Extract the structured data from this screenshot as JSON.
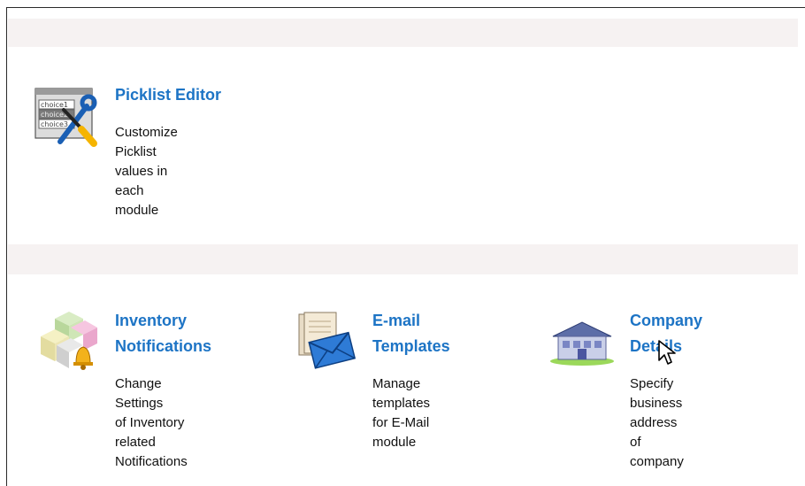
{
  "sections": [
    {
      "items": [
        {
          "title_line1": "Picklist Editor",
          "title_line2": "",
          "desc_line1": "Customize Picklist",
          "desc_line2": "values in each",
          "desc_line3": "module",
          "desc_line4": "",
          "icon": "picklist-editor-icon",
          "icon_text": [
            "choice1",
            "choice2",
            "choice3"
          ]
        }
      ]
    },
    {
      "items": [
        {
          "title_line1": "Inventory",
          "title_line2": "Notifications",
          "desc_line1": "Change Settings",
          "desc_line2": "of Inventory",
          "desc_line3": "related",
          "desc_line4": "Notifications",
          "icon": "inventory-notification-icon"
        },
        {
          "title_line1": "E-mail",
          "title_line2": "Templates",
          "desc_line1": "Manage templates",
          "desc_line2": "for E-Mail module",
          "desc_line3": "",
          "desc_line4": "",
          "icon": "email-templates-icon"
        },
        {
          "title_line1": "Company",
          "title_line2": "Details",
          "desc_line1": "Specify business",
          "desc_line2": "address of",
          "desc_line3": "company",
          "desc_line4": "",
          "icon": "company-building-icon"
        }
      ]
    }
  ],
  "colors": {
    "link": "#1d74c5",
    "band": "#f6f2f2",
    "text": "#111111"
  }
}
